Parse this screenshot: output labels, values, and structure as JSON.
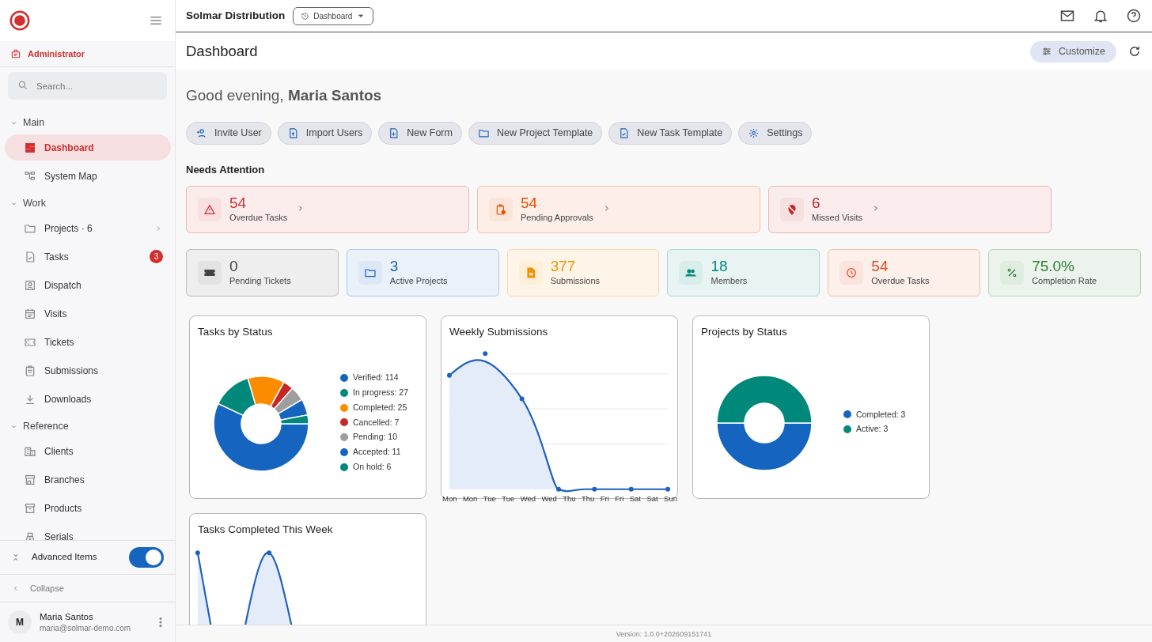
{
  "app": {
    "title": "Solmar Distribution",
    "view_selector": "Dashboard",
    "role": "Administrator"
  },
  "sidebar": {
    "search_placeholder": "Search...",
    "sections": [
      {
        "label": "Main",
        "expanded": true,
        "items": [
          {
            "label": "Dashboard",
            "selected": true,
            "has_submenu": false
          },
          {
            "label": "System Map",
            "selected": false,
            "has_submenu": false
          }
        ]
      },
      {
        "label": "Work",
        "expanded": true,
        "items": [
          {
            "label": "Projects · 6",
            "selected": false,
            "has_submenu": true
          },
          {
            "label": "Tasks",
            "selected": false,
            "has_submenu": false,
            "badge": "3"
          },
          {
            "label": "Dispatch",
            "selected": false,
            "has_submenu": false
          },
          {
            "label": "Visits",
            "selected": false,
            "has_submenu": false
          },
          {
            "label": "Tickets",
            "selected": false,
            "has_submenu": false
          },
          {
            "label": "Submissions",
            "selected": false,
            "has_submenu": false
          },
          {
            "label": "Downloads",
            "selected": false,
            "has_submenu": false
          }
        ]
      },
      {
        "label": "Reference",
        "expanded": true,
        "items": [
          {
            "label": "Clients",
            "selected": false,
            "has_submenu": false
          },
          {
            "label": "Branches",
            "selected": false,
            "has_submenu": false
          },
          {
            "label": "Products",
            "selected": false,
            "has_submenu": false
          },
          {
            "label": "Serials",
            "selected": false,
            "has_submenu": false
          }
        ]
      }
    ],
    "advanced_items": {
      "label": "Advanced Items",
      "on": true
    },
    "collapse": "Collapse",
    "user": {
      "initial": "M",
      "name": "Maria Santos",
      "email": "maria@solmar-demo.com"
    }
  },
  "page": {
    "title": "Dashboard",
    "customize": "Customize"
  },
  "greeting": "Good evening, **Maria Santos**",
  "quick_actions": [
    "Invite User",
    "Import Users",
    "New Form",
    "New Project Template",
    "New Task Template",
    "Settings"
  ],
  "needs_attention": {
    "title": "Needs Attention",
    "items": [
      {
        "value": "54",
        "label": "Overdue Tasks",
        "color": "#d32f2f"
      },
      {
        "value": "54",
        "label": "Pending Approvals",
        "color": "#e65100"
      },
      {
        "value": "6",
        "label": "Missed Visits",
        "color": "#c62828"
      }
    ]
  },
  "stats": [
    {
      "value": "0",
      "label": "Pending Tickets",
      "color": "#424242"
    },
    {
      "value": "3",
      "label": "Active Projects",
      "color": "#1565c0"
    },
    {
      "value": "377",
      "label": "Submissions",
      "color": "#f29100"
    },
    {
      "value": "18",
      "label": "Members",
      "color": "#00897b"
    },
    {
      "value": "54",
      "label": "Overdue Tasks",
      "color": "#e64a19"
    },
    {
      "value": "75.0%",
      "label": "Completion Rate",
      "color": "#2e7d32"
    }
  ],
  "charts": [
    {
      "kind": "donut",
      "title": "Tasks by Status",
      "chart_data": {
        "type": "donut",
        "categories": [
          "Verified: 114",
          "In progress: 27",
          "Completed: 25",
          "Cancelled: 7",
          "Pending: 10",
          "Accepted: 11",
          "On hold: 6"
        ],
        "values": [
          114,
          27,
          25,
          7,
          10,
          11,
          6
        ]
      },
      "legend": [
        {
          "color": "#1565c0"
        },
        {
          "color": "#00897b"
        },
        {
          "color": "#fb8c00"
        },
        {
          "color": "#c62828"
        },
        {
          "color": "#9e9e9e"
        },
        {
          "color": "#1565c0"
        },
        {
          "color": "#00897b"
        }
      ]
    },
    {
      "kind": "line",
      "title": "Weekly Submissions",
      "x_labels": [
        "Mon",
        "Mon",
        "Tue",
        "Tue",
        "Wed",
        "Wed",
        "Thu",
        "Thu",
        "Fri",
        "Fri",
        "Sat",
        "Sat",
        "Sun"
      ]
    },
    {
      "kind": "donut",
      "title": "Projects by Status",
      "chart_data": {
        "type": "donut",
        "categories": [
          "Completed: 3",
          "Active: 3"
        ],
        "values": [
          3,
          3
        ]
      },
      "legend": [
        {
          "color": "#1565c0"
        },
        {
          "color": "#00897b"
        }
      ]
    },
    {
      "kind": "line",
      "title": "Tasks Completed This Week"
    }
  ],
  "footer": "Version: 1.0.0+202609151741"
}
